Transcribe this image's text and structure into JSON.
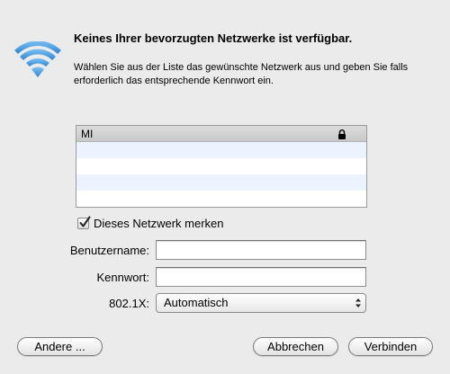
{
  "dialog": {
    "title": "Keines Ihrer bevorzugten Netzwerke ist verfügbar.",
    "description": "Wählen Sie aus der Liste das gewünschte Netzwerk aus und geben Sie falls erforderlich das entsprechende Kennwort ein."
  },
  "network_list": {
    "rows": [
      {
        "name": "MI",
        "secured": true
      },
      {
        "name": ""
      },
      {
        "name": ""
      },
      {
        "name": ""
      },
      {
        "name": ""
      }
    ]
  },
  "remember": {
    "label": "Dieses Netzwerk merken",
    "checked": true
  },
  "form": {
    "username_label": "Benutzername:",
    "username_value": "",
    "password_label": "Kennwort:",
    "password_value": "",
    "dot1x_label": "802.1X:",
    "dot1x_value": "Automatisch"
  },
  "buttons": {
    "other": "Andere ...",
    "cancel": "Abbrechen",
    "connect": "Verbinden"
  },
  "colors": {
    "background": "#ebebeb",
    "wifi_icon": "#3a8fd8",
    "list_alt_row": "#edf3fe"
  }
}
